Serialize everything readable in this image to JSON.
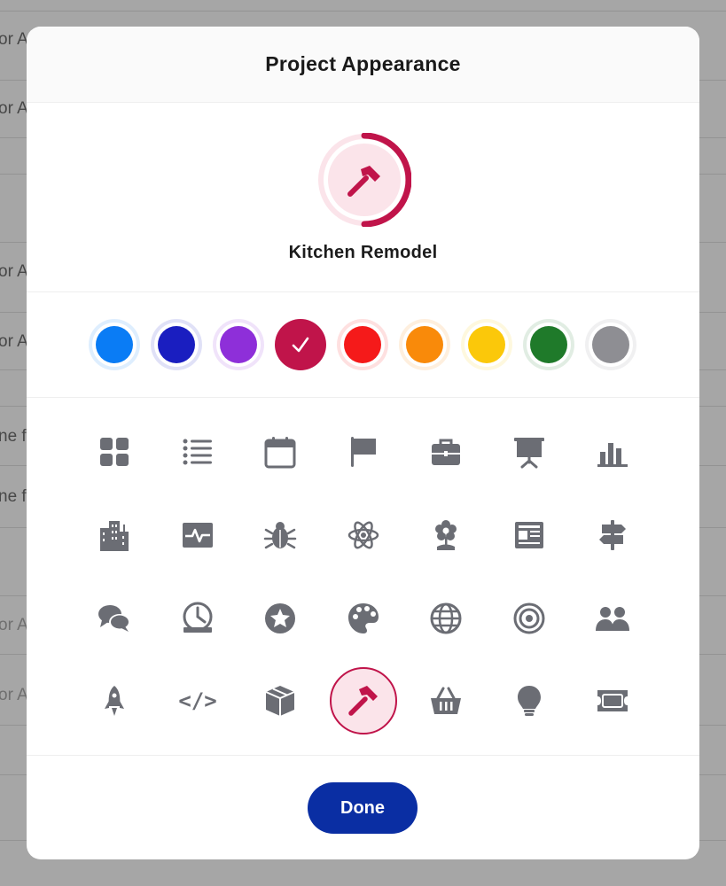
{
  "background": {
    "rows": [
      {
        "text": "or A",
        "dim": false
      },
      {
        "text": "or A",
        "dim": false
      },
      {
        "text": "or A",
        "dim": false
      },
      {
        "text": "or A",
        "dim": false
      },
      {
        "text": "ne f",
        "dim": false
      },
      {
        "text": "ne f",
        "dim": false
      },
      {
        "text": "or A",
        "dim": true
      },
      {
        "text": "or A",
        "dim": true
      }
    ]
  },
  "modal": {
    "title": "Project Appearance",
    "project_name": "Kitchen Remodel",
    "done_label": "Done"
  },
  "colors": {
    "selected": "#c0144a",
    "accent_light": "#fbe4ea",
    "swatches": [
      "#0a7cf5",
      "#1a1ec0",
      "#8e2fd9",
      "#c0144a",
      "#f51a1a",
      "#f98a0a",
      "#fbc80a",
      "#1f7a2a",
      "#8e8e93"
    ]
  },
  "icons": [
    [
      "grid-icon",
      "list-icon",
      "calendar-icon",
      "flag-icon",
      "briefcase-icon",
      "presentation-icon",
      "bar-chart-icon"
    ],
    [
      "buildings-icon",
      "pulse-icon",
      "bug-icon",
      "atom-icon",
      "flower-icon",
      "newspaper-icon",
      "signpost-icon"
    ],
    [
      "chat-bubbles-icon",
      "gauge-icon",
      "star-badge-icon",
      "palette-icon",
      "globe-icon",
      "target-icon",
      "people-icon"
    ],
    [
      "rocket-icon",
      "code-icon",
      "package-icon",
      "hammer-icon",
      "basket-icon",
      "lightbulb-icon",
      "ticket-icon"
    ]
  ],
  "selected_icon": "hammer-icon",
  "code_glyph": "</>"
}
